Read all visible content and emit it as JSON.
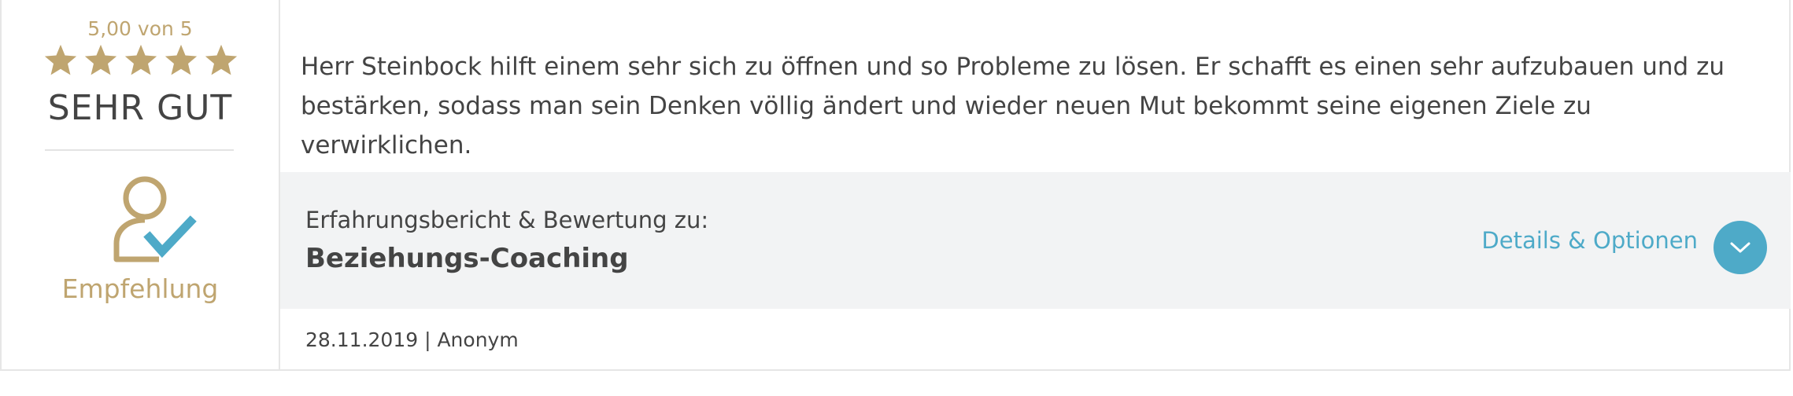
{
  "rating": {
    "score_text": "5,00 von 5",
    "stars": 5,
    "verdict": "SEHR GUT",
    "recommendation_label": "Empfehlung"
  },
  "review": {
    "text": "Herr Steinbock hilft einem sehr sich zu öffnen und so Probleme zu lösen. Er schafft es einen sehr aufzubauen und zu bestärken, sodass man sein Denken völlig ändert und wieder neuen Mut bekommt seine eigenen Ziele zu verwirklichen."
  },
  "meta": {
    "caption": "Erfahrungsbericht & Bewertung zu:",
    "subject": "Beziehungs-Coaching",
    "details_label": "Details & Optionen"
  },
  "footer": {
    "date_author": "28.11.2019 | Anonym"
  },
  "colors": {
    "gold": "#bfa570",
    "accent_blue": "#4eaac8",
    "text": "#444444",
    "panel_bg": "#f2f3f4"
  },
  "icons": [
    "star-icon",
    "recommend-person-check-icon",
    "chevron-down-icon"
  ]
}
